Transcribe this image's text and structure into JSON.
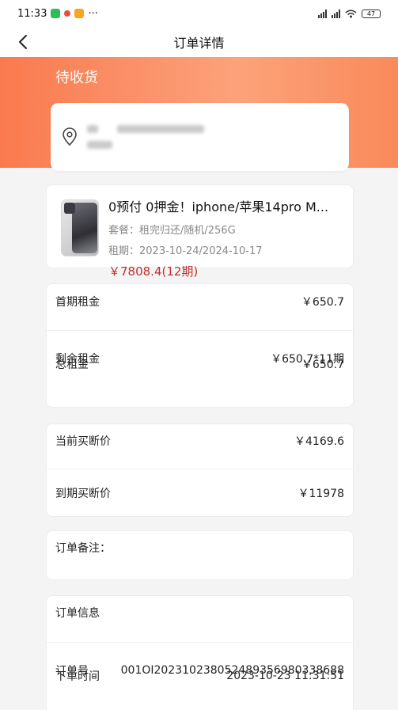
{
  "status_bar": {
    "time": "11:33",
    "more": "···",
    "battery": "47"
  },
  "nav": {
    "title": "订单详情"
  },
  "order_status": "待收货",
  "product": {
    "title": "0预付 0押金！iphone/苹果14pro M...",
    "package": "套餐：租完归还/随机/256G",
    "period": "租期：2023-10-24/2024-10-17",
    "price": "￥7808.4(12期)"
  },
  "rent": {
    "first_label": "首期租金",
    "first_value": "￥650.7",
    "remaining_label": "剩余租金",
    "remaining_value": "￥650.7*11期",
    "total_label": "总租金",
    "total_value": "￥650.7"
  },
  "buyout": {
    "current_label": "当前买断价",
    "current_value": "￥4169.6",
    "expiry_label": "到期买断价",
    "expiry_value": "￥11978"
  },
  "remark": {
    "label": "订单备注："
  },
  "order_info": {
    "title": "订单信息",
    "number_label": "订单号",
    "number_value": "001OI20231023805248935698033868​8",
    "time_label": "下单时间",
    "time_value": "2023-10-23 11:31:51"
  },
  "colors": {
    "hero_gradient_start": "#fa7a4e",
    "price_red": "#c0312b"
  }
}
